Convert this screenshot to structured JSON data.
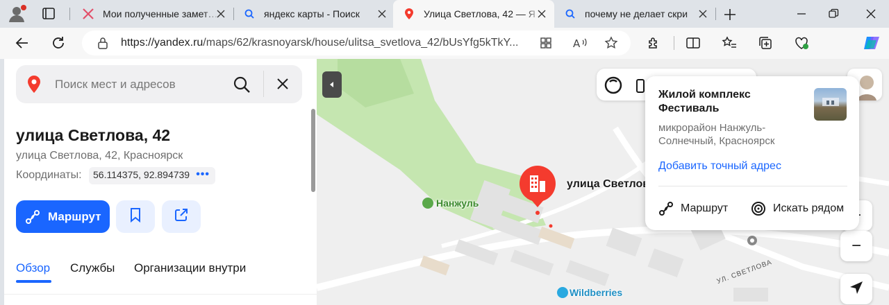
{
  "browser": {
    "tabs": [
      {
        "title": "Мои полученные замет…",
        "icon": "pink-x-icon"
      },
      {
        "title": "яндекс карты - Поиск",
        "icon": "search-favicon"
      },
      {
        "title": "Улица Светлова, 42 — Я",
        "icon": "yandex-maps-pin-icon"
      },
      {
        "title": "почему не делает скри",
        "icon": "search-favicon"
      }
    ],
    "url_host": "https://yandex.ru",
    "url_path": "/maps/62/krasnoyarsk/house/ulitsa_svetlova_42/bUsYfg5kTkY..."
  },
  "panel": {
    "search_placeholder": "Поиск мест и адресов",
    "title": "улица Светлова, 42",
    "subtitle": "улица Светлова, 42, Красноярск",
    "coords_label": "Координаты:",
    "coords_value": "56.114375, 92.894739",
    "coords_more": "•••",
    "route_label": "Маршрут",
    "tabs": [
      "Обзор",
      "Службы",
      "Организации внутри"
    ]
  },
  "map": {
    "pin_label": "улица Светлова",
    "poi_nanzhul": "Нанжуль",
    "poi_wildberries": "Wildberries",
    "street": "УЛ. СВЕТЛОВА",
    "zoom_minus": "−",
    "zoom_plus": "+"
  },
  "card": {
    "title": "Жилой комплекс Фестиваль",
    "subtitle": "микрорайон Нанжуль-Солнечный, Красноярск",
    "link": "Добавить точный адрес",
    "route": "Маршрут",
    "nearby": "Искать рядом"
  },
  "colors": {
    "accent": "#1a66ff",
    "pin": "#f43b2e",
    "park": "#c5e6b0"
  }
}
